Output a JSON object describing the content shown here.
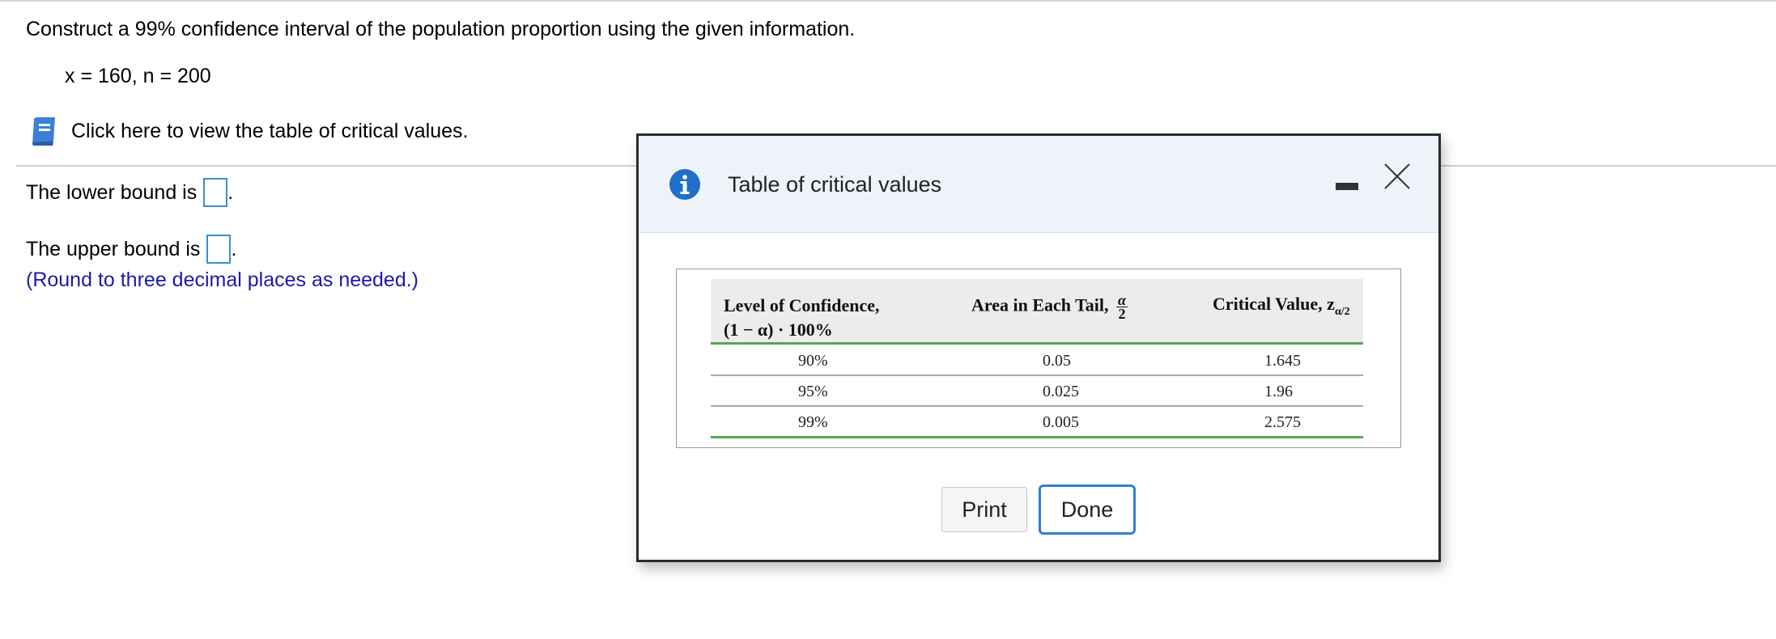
{
  "question": {
    "prompt": "Construct a 99% confidence interval of the population proportion using the given information.",
    "given": "x = 160, n = 200",
    "table_link": "Click here to view the table of critical values.",
    "lower_label": "The lower bound is",
    "upper_label": "The upper bound is",
    "period": ".",
    "note": "(Round to three decimal places as needed.)"
  },
  "dialog": {
    "title": "Table of critical values",
    "headers": {
      "col1_line1": "Level of Confidence,",
      "col1_line2": "(1 − α) · 100%",
      "col2": "Area in Each Tail,",
      "col2_frac_num": "α",
      "col2_frac_den": "2",
      "col3": "Critical Value, z",
      "col3_sub": "α/2"
    },
    "rows": [
      {
        "confidence": "90%",
        "area": "0.05",
        "critical": "1.645"
      },
      {
        "confidence": "95%",
        "area": "0.025",
        "critical": "1.96"
      },
      {
        "confidence": "99%",
        "area": "0.005",
        "critical": "2.575"
      }
    ],
    "print_label": "Print",
    "done_label": "Done"
  },
  "colors": {
    "link_text": "#1b1ba6",
    "answer_box_border": "#3a8fc8",
    "header_bg": "#eef3f9",
    "table_rule": "#53a957",
    "done_border": "#2f7fd3"
  },
  "icons": [
    "book-icon",
    "info-icon",
    "minimize-icon",
    "close-icon"
  ]
}
